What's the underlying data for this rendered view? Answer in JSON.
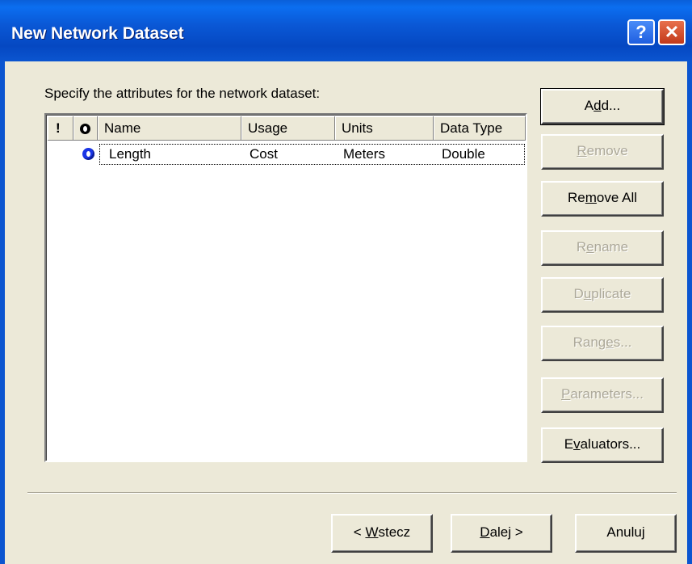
{
  "window": {
    "title": "New Network Dataset",
    "help_glyph": "?",
    "close_glyph": "✕"
  },
  "instructions": "Specify the attributes for the network dataset:",
  "table": {
    "columns": [
      {
        "key": "warning",
        "label": "!",
        "icon": "exclamation-icon"
      },
      {
        "key": "default",
        "label": "",
        "icon": "default-attribute-icon"
      },
      {
        "key": "name",
        "label": "Name"
      },
      {
        "key": "usage",
        "label": "Usage"
      },
      {
        "key": "units",
        "label": "Units"
      },
      {
        "key": "data_type",
        "label": "Data Type"
      }
    ],
    "rows": [
      {
        "default_icon": "default-attribute-icon",
        "name": "Length",
        "usage": "Cost",
        "units": "Meters",
        "data_type": "Double"
      }
    ]
  },
  "buttons": {
    "add": {
      "pre": "A",
      "mn": "d",
      "post": "d...",
      "enabled": true
    },
    "remove": {
      "pre": "",
      "mn": "R",
      "post": "emove",
      "enabled": false
    },
    "remove_all": {
      "pre": "Re",
      "mn": "m",
      "post": "ove All",
      "enabled": true
    },
    "rename": {
      "pre": "R",
      "mn": "e",
      "post": "name",
      "enabled": false
    },
    "duplicate": {
      "pre": "D",
      "mn": "u",
      "post": "plicate",
      "enabled": false
    },
    "ranges": {
      "pre": "Rang",
      "mn": "e",
      "post": "s...",
      "enabled": false
    },
    "parameters": {
      "pre": "",
      "mn": "P",
      "post": "arameters...",
      "enabled": false
    },
    "evaluators": {
      "pre": "E",
      "mn": "v",
      "post": "aluators...",
      "enabled": true
    }
  },
  "nav": {
    "back": {
      "pre": "< ",
      "mn": "W",
      "post": "stecz"
    },
    "next": {
      "pre": "",
      "mn": "D",
      "post": "alej >"
    },
    "cancel": {
      "label": "Anuluj"
    }
  },
  "colors": {
    "titlebar": "#0a5fd9",
    "dialog_bg": "#ece9d8",
    "disabled_text": "#aca899",
    "default_icon": "#1a35e6"
  }
}
